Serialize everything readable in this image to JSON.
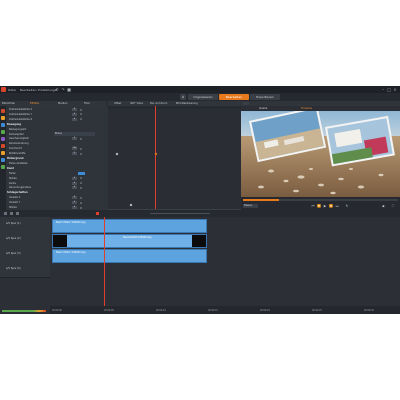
{
  "title_bar": {
    "menus": [
      "Datei",
      "Bearbeiten",
      "Einstellungen"
    ]
  },
  "mode_tabs": [
    {
      "label": "Organisieren",
      "active": false
    },
    {
      "label": "Bearbeiten",
      "active": true
    },
    {
      "label": "Exportieren",
      "active": false
    }
  ],
  "props_tabs": [
    "Bibliothek",
    "Effekte",
    "Medien",
    "Titel"
  ],
  "properties": [
    {
      "label": "Drehwinkelstärke X",
      "value": "0",
      "type": "num"
    },
    {
      "label": "Drehwinkelstärke Y",
      "value": "0",
      "type": "num"
    },
    {
      "label": "Drehwinkelstärke Z",
      "value": "0",
      "type": "num"
    },
    {
      "label": "Bewegung",
      "type": "header"
    },
    {
      "label": "Bewegungsart",
      "type": "plain"
    },
    {
      "label": "Kamerapfad",
      "value": "Ebene",
      "type": "dropdown"
    },
    {
      "label": "Geschwindigkeit",
      "value": "0",
      "type": "num"
    },
    {
      "label": "Randerwiderung",
      "type": "plain"
    },
    {
      "label": "Durchsicht",
      "value": "100",
      "type": "num"
    },
    {
      "label": "Rotationshilfe",
      "value": "0",
      "type": "num"
    },
    {
      "label": "Hintergrund",
      "type": "header"
    },
    {
      "label": "Farbe einstellen",
      "type": "plain"
    },
    {
      "label": "Rand",
      "type": "header"
    },
    {
      "label": "Farbe",
      "value": "",
      "type": "blue"
    },
    {
      "label": "Stärke",
      "value": "0",
      "type": "num"
    },
    {
      "label": "Kante",
      "value": "0",
      "type": "num"
    },
    {
      "label": "Abrundungsradius",
      "value": "0",
      "type": "num"
    },
    {
      "label": "Schlagschatten",
      "type": "header"
    },
    {
      "label": "Versatz X",
      "value": "0",
      "type": "num"
    },
    {
      "label": "Versatz Y",
      "value": "0",
      "type": "num"
    },
    {
      "label": "Stärke",
      "value": "0",
      "type": "num"
    }
  ],
  "keyframe_header": [
    "Offset",
    "360° Video",
    "Pan und Zoom",
    "Bild-Stabilisierung"
  ],
  "preview": {
    "top_tabs": [
      "Quelle",
      "Timeline"
    ],
    "zoom": "Passen"
  },
  "timeline": {
    "tracks": [
      {
        "name": "A/V Spur (1)"
      },
      {
        "name": "A/V Spur (2)"
      },
      {
        "name": "A/V Spur (3)"
      },
      {
        "name": "A/V Spur (4)"
      }
    ],
    "clips": [
      {
        "label": "Beach Motion Sc8006.mpg"
      },
      {
        "label": "Standardbild Sc8006.mpg"
      },
      {
        "label": "Beach Motion Sc8006.mpg"
      }
    ],
    "ruler": [
      "00:00:00",
      "00:00:05",
      "00:00:10",
      "00:00:15",
      "00:00:20",
      "00:00:25",
      "00:00:30"
    ]
  },
  "colors": {
    "accent": "#e87a1e",
    "clip": "#5da3e0",
    "playhead": "#e0402a"
  }
}
